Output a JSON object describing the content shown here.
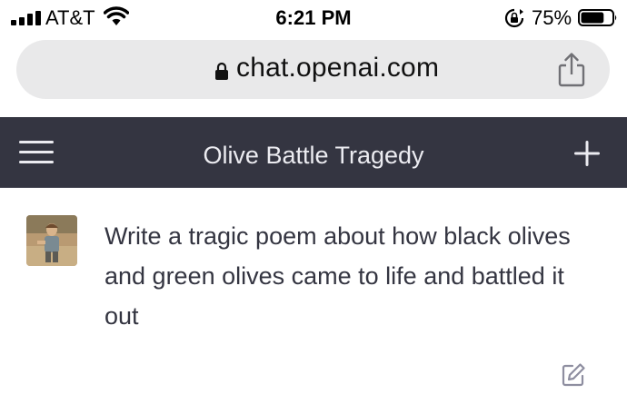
{
  "status_bar": {
    "carrier": "AT&T",
    "time": "6:21 PM",
    "battery_percent": "75%",
    "battery_level": 0.75,
    "icons": [
      "signal-icon",
      "wifi-icon",
      "rotation-lock-icon",
      "battery-icon"
    ]
  },
  "browser": {
    "url": "chat.openai.com",
    "icons": [
      "lock-icon",
      "share-icon"
    ]
  },
  "header": {
    "title": "Olive Battle Tragedy",
    "icons": [
      "menu-icon",
      "new-chat-plus-icon"
    ]
  },
  "conversation": {
    "user_message": "Write a tragic poem about how black olives and green olives came to life and battled it out",
    "icons": [
      "user-avatar",
      "edit-icon"
    ]
  },
  "colors": {
    "header_bg": "#343541",
    "header_text": "#ececf1",
    "address_bar_bg": "#e9e9ea",
    "message_text": "#343541",
    "icon_gray": "#8e8ea0"
  }
}
